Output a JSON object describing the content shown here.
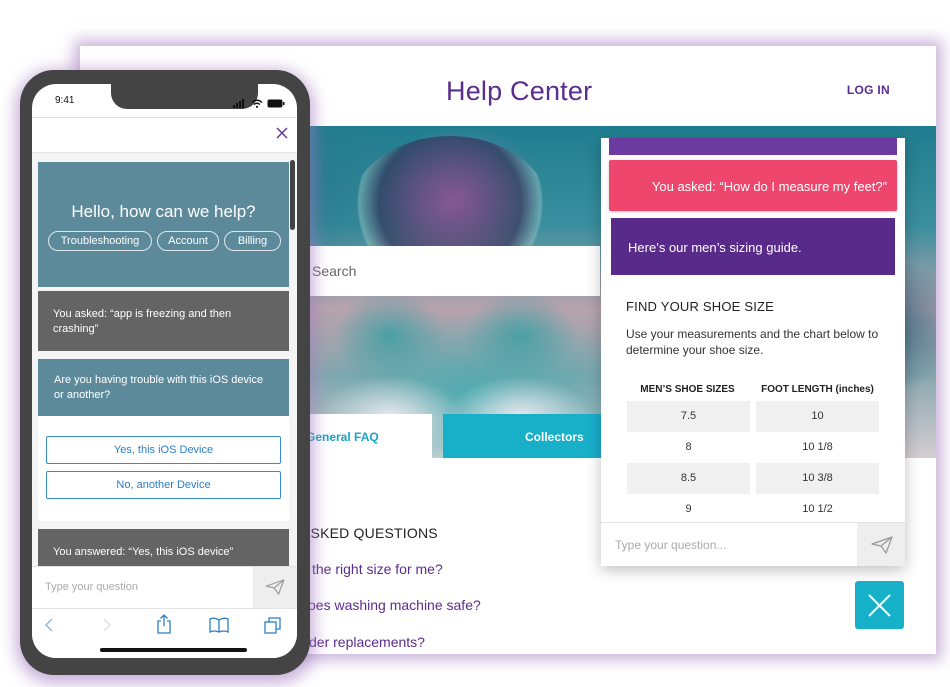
{
  "desktop": {
    "title": "Help Center",
    "login_label": "LOG IN",
    "search_placeholder": "Search",
    "tabs": [
      {
        "label": "General FAQ",
        "active": true
      },
      {
        "label": "Collectors",
        "active": false
      }
    ],
    "faq_heading": "ASKED QUESTIONS",
    "faq_links": [
      "the right size for me?",
      "oes washing machine safe?",
      "der replacements?"
    ]
  },
  "chat_widget": {
    "asked": "You asked: “How do I measure my feet?”",
    "answer": "Here’s our men’s sizing guide.",
    "heading": "FIND YOUR SHOE SIZE",
    "description": "Use your measurements and the chart below to determine your shoe size.",
    "table": {
      "headers": [
        "MEN’S SHOE SIZES",
        "FOOT LENGTH (inches)"
      ],
      "rows": [
        [
          "7.5",
          "10"
        ],
        [
          "8",
          "10 1/8"
        ],
        [
          "8.5",
          "10 3/8"
        ],
        [
          "9",
          "10 1/2"
        ]
      ]
    },
    "input_placeholder": "Type your question...",
    "send_icon": "paper-plane-icon",
    "close_icon": "close-icon"
  },
  "phone": {
    "status_time": "9:41",
    "status_icons": [
      "signal-icon",
      "wifi-icon",
      "battery-icon"
    ],
    "close_icon": "close-icon",
    "hello_title": "Hello, how can we help?",
    "chips": [
      "Troubleshooting",
      "Account",
      "Billing"
    ],
    "messages": [
      {
        "type": "user",
        "text": "You asked: “app is freezing and then crashing”"
      },
      {
        "type": "bot",
        "text": "Are you having trouble with this iOS device or another?"
      },
      {
        "type": "user",
        "text": "You answered: “Yes, this iOS device”"
      }
    ],
    "options": [
      "Yes, this iOS Device",
      "No, another Device"
    ],
    "input_placeholder": "Type your question",
    "safari_icons": [
      "back-icon",
      "forward-icon",
      "share-icon",
      "bookmarks-icon",
      "tabs-icon"
    ]
  },
  "colors": {
    "brand_purple": "#5b2d8e",
    "accent_teal": "#17b0c9",
    "asked_pink": "#ee466d",
    "bot_slate": "#5d8a9b",
    "user_gray": "#646464"
  }
}
